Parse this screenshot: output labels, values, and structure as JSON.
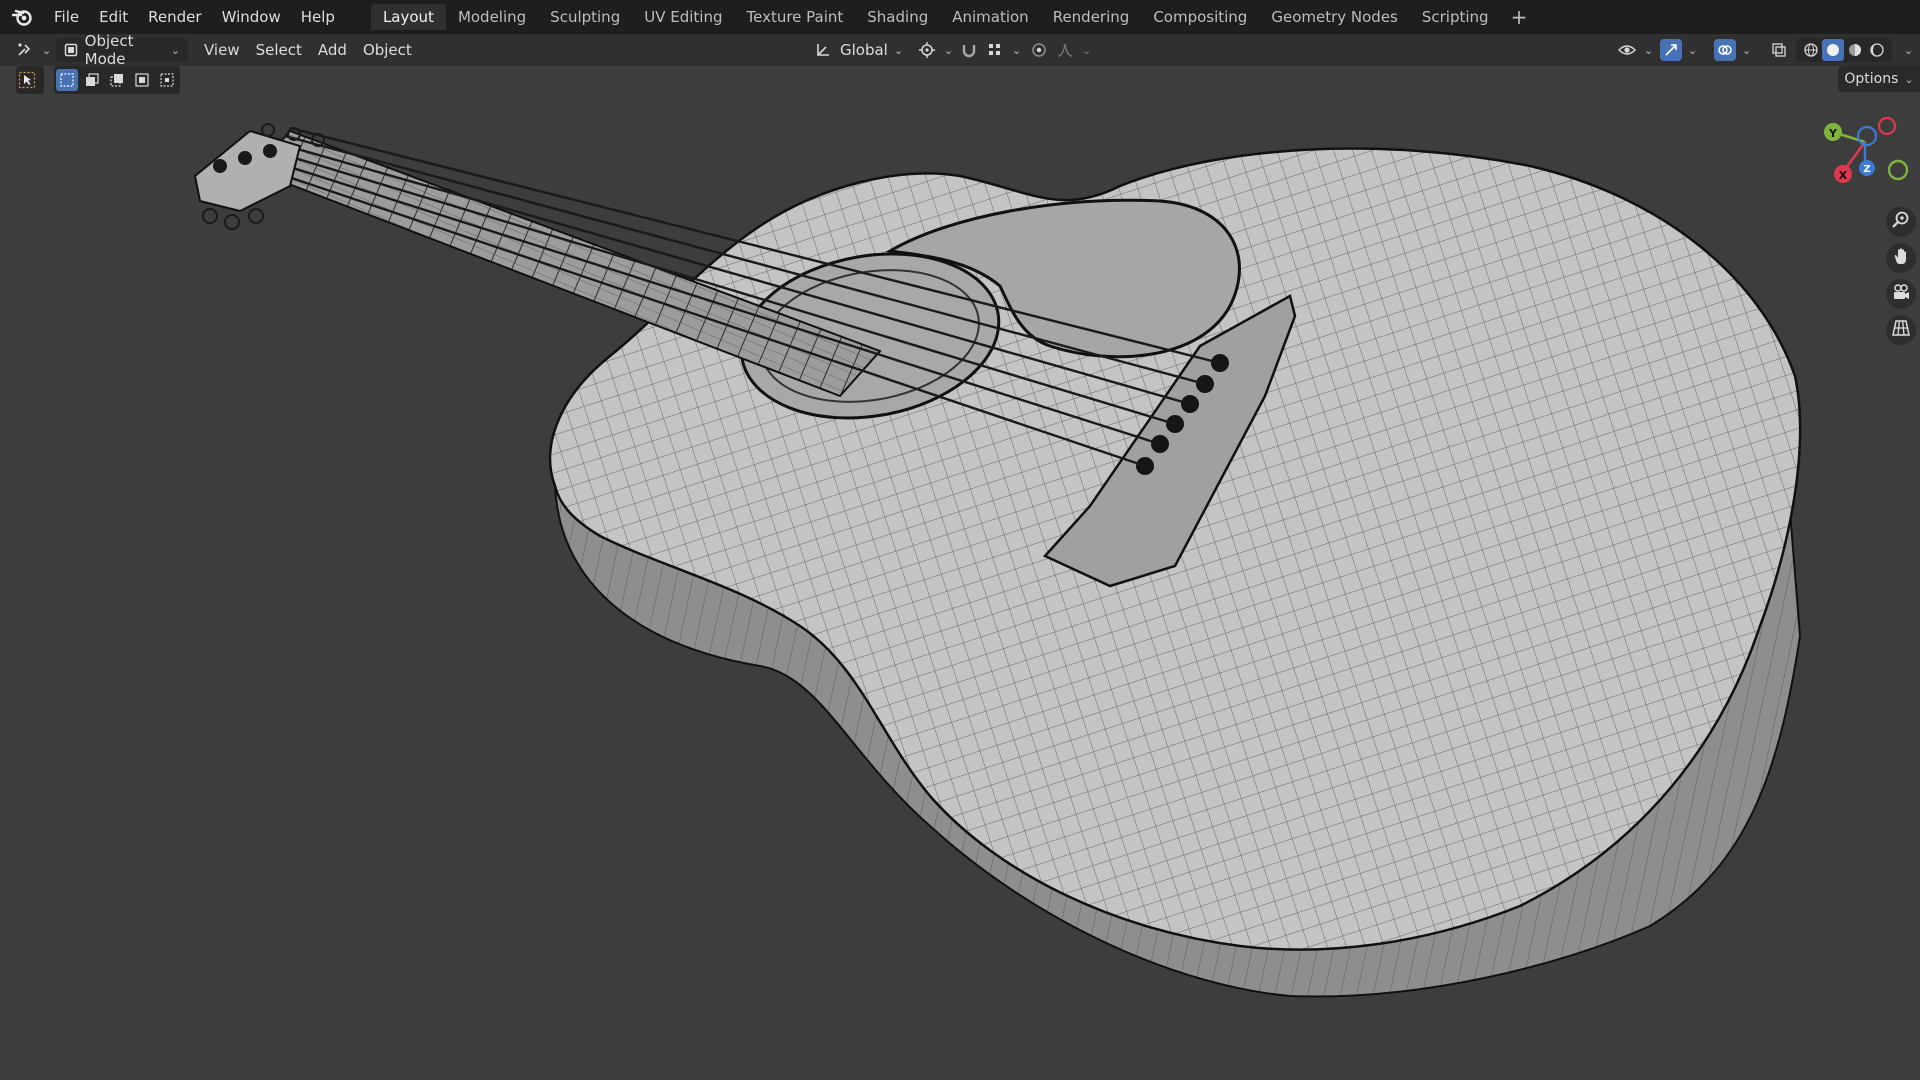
{
  "topbar": {
    "menus": [
      "File",
      "Edit",
      "Render",
      "Window",
      "Help"
    ],
    "workspaces": [
      "Layout",
      "Modeling",
      "Sculpting",
      "UV Editing",
      "Texture Paint",
      "Shading",
      "Animation",
      "Rendering",
      "Compositing",
      "Geometry Nodes",
      "Scripting"
    ],
    "active_workspace": "Layout",
    "add_label": "+"
  },
  "header": {
    "mode": "Object Mode",
    "menus": [
      "View",
      "Select",
      "Add",
      "Object"
    ],
    "orientation": "Global"
  },
  "viewport": {
    "options_label": "Options",
    "gizmo": {
      "y": "Y",
      "x": "X",
      "z": "Z"
    }
  },
  "icons": {
    "logo": "blender-logo-icon",
    "editor_type": "editor-type-icon",
    "transform_orientation": "orientation-icon",
    "pivot": "pivot-icon",
    "snap": "snap-magnet-icon",
    "proportional": "proportional-edit-icon",
    "visibility": "visibility-icon",
    "gizmo_toggle": "gizmo-toggle-icon",
    "overlay": "overlay-icon",
    "xray": "xray-icon",
    "shading": [
      "wireframe-shading-icon",
      "solid-shading-icon",
      "material-shading-icon",
      "rendered-shading-icon"
    ],
    "nav": [
      "zoom-icon",
      "pan-hand-icon",
      "camera-view-icon",
      "ortho-grid-icon"
    ]
  },
  "colors": {
    "accent": "#4772b3",
    "axis_x": "#e0384d",
    "axis_y": "#7eb43a",
    "axis_z": "#3d7ad6"
  }
}
